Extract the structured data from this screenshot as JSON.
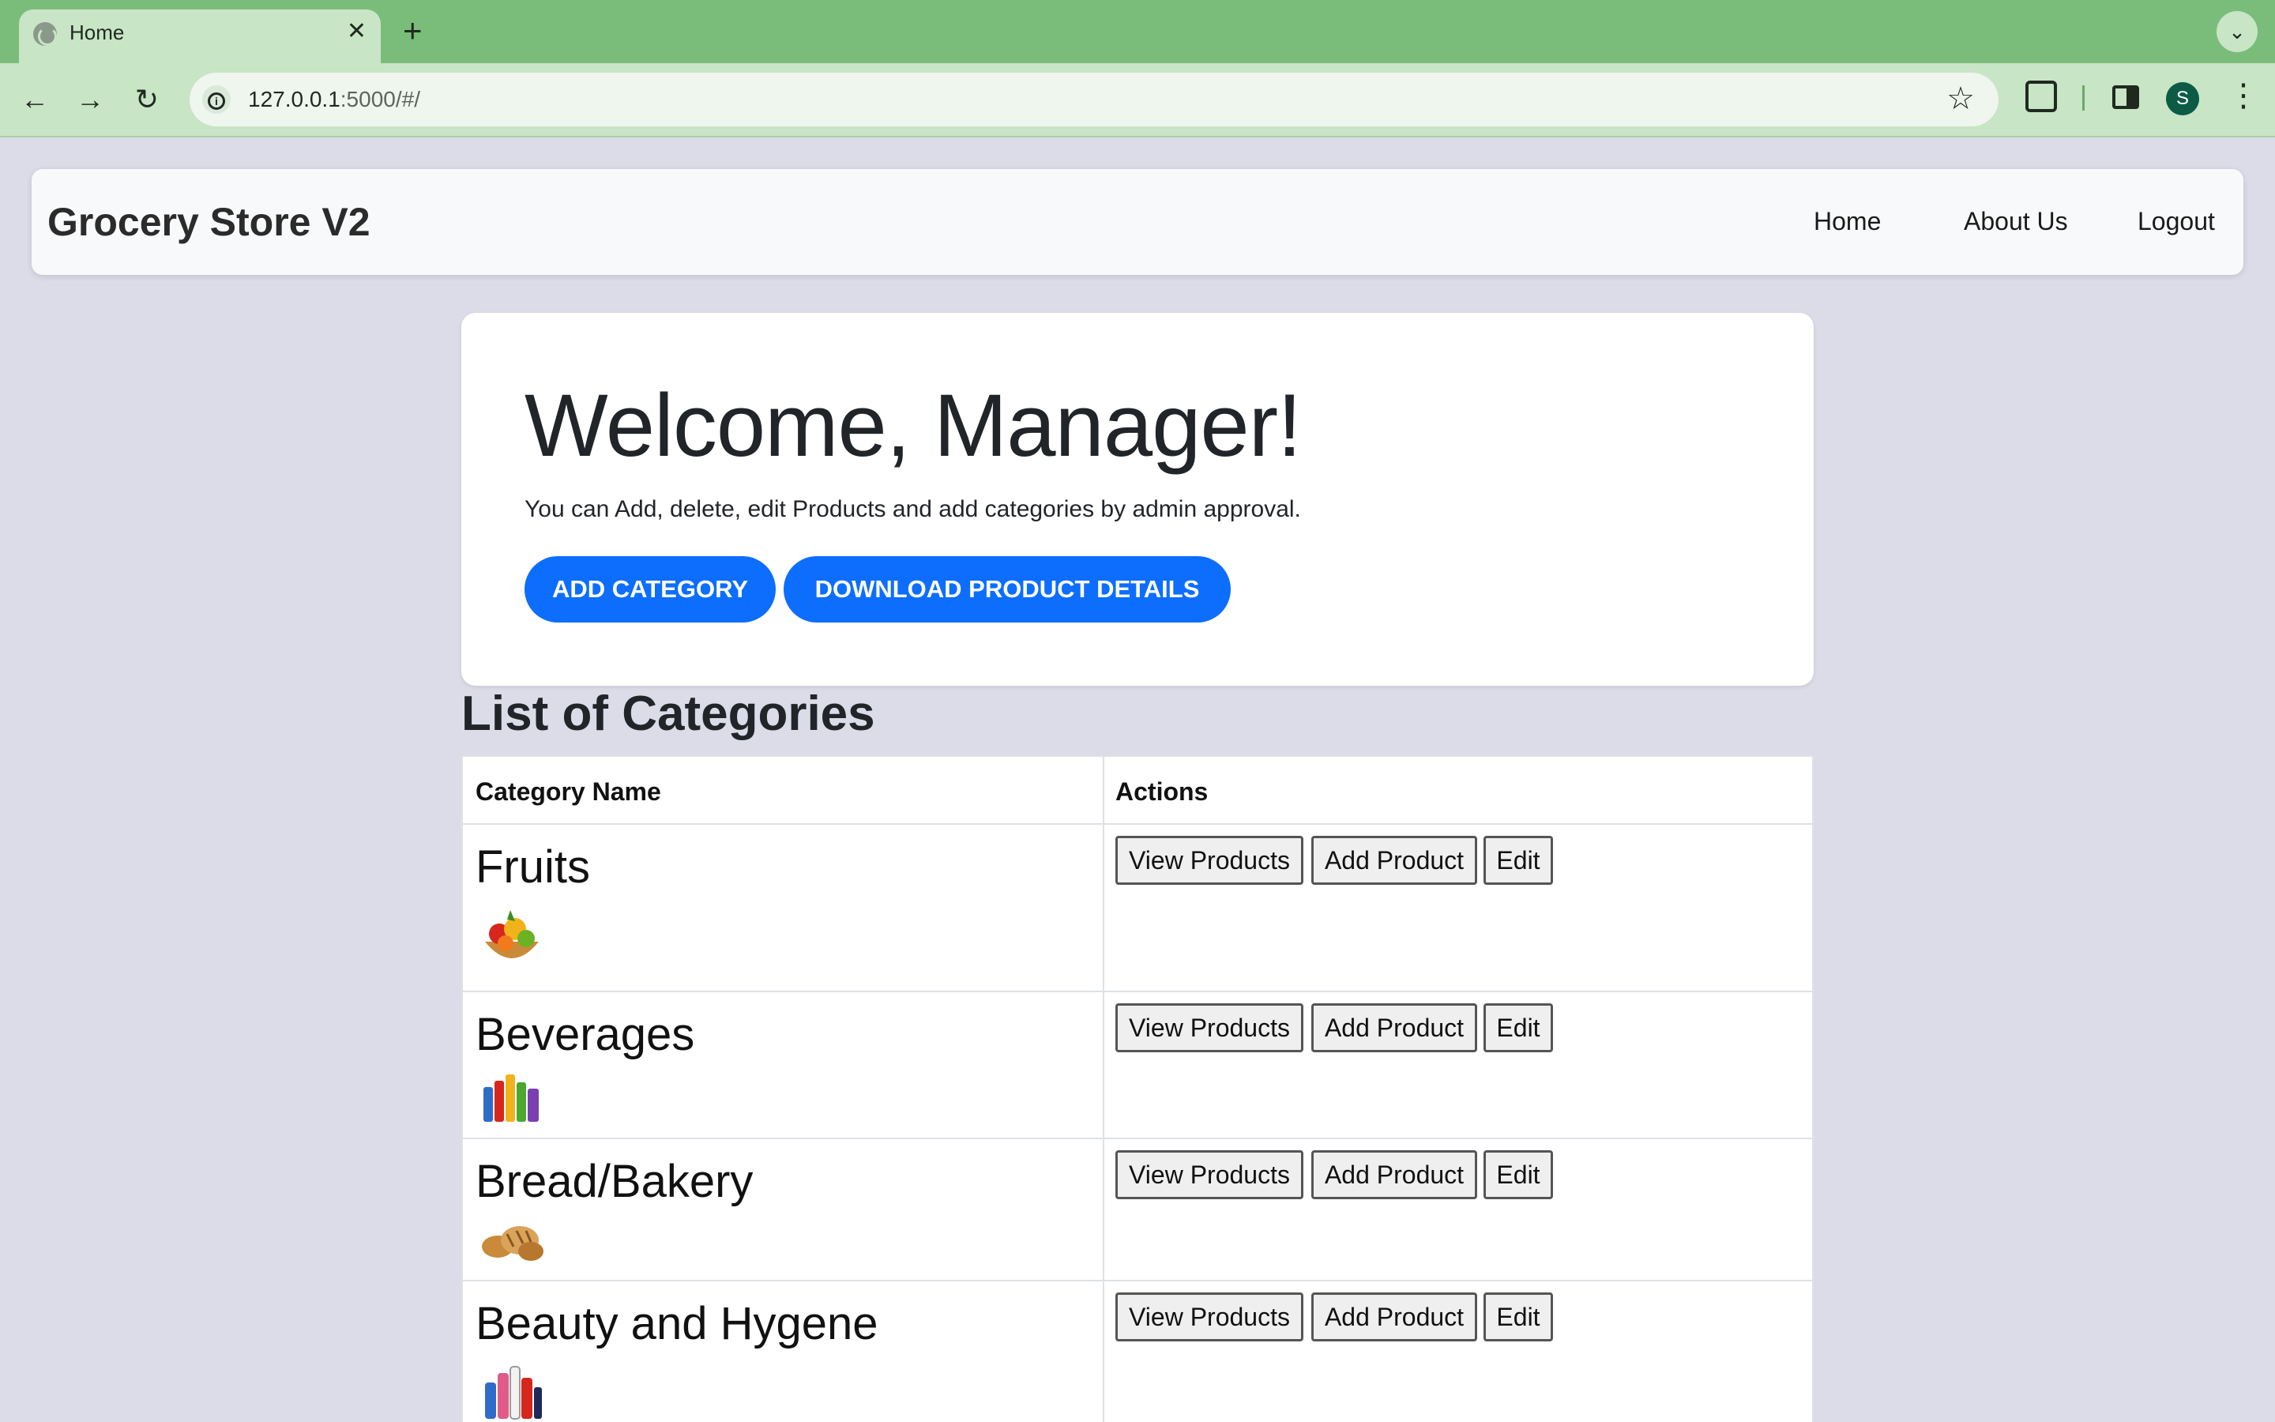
{
  "browser": {
    "tab_title": "Home",
    "tab_close": "✕",
    "new_tab": "+",
    "tab_menu": "⌄",
    "url_host": "127.0.0.1",
    "url_rest": ":5000/#/",
    "profile_initial": "S",
    "back": "←",
    "forward": "→",
    "reload": "↻",
    "star": "☆",
    "menu": "⋮"
  },
  "navbar": {
    "brand": "Grocery Store V2",
    "links": [
      "Home",
      "About Us",
      "Logout"
    ]
  },
  "hero": {
    "title": "Welcome, Manager!",
    "lead": "You can Add, delete, edit Products and add categories by admin approval.",
    "add_category": "ADD CATEGORY",
    "download": "DOWNLOAD PRODUCT DETAILS"
  },
  "categories": {
    "title": "List of Categories",
    "headers": [
      "Category Name",
      "Actions"
    ],
    "actions": [
      "View Products",
      "Add Product",
      "Edit"
    ],
    "rows": [
      {
        "name": "Fruits",
        "image": "fruit-basket"
      },
      {
        "name": "Beverages",
        "image": "beverage-bottles"
      },
      {
        "name": "Bread/Bakery",
        "image": "bread-basket"
      },
      {
        "name": "Beauty and Hygene",
        "image": "beauty-products"
      }
    ]
  },
  "colors": {
    "primary": "#0d6efd",
    "chrome_green": "#7abd7b",
    "page_bg": "#dcdce8"
  }
}
